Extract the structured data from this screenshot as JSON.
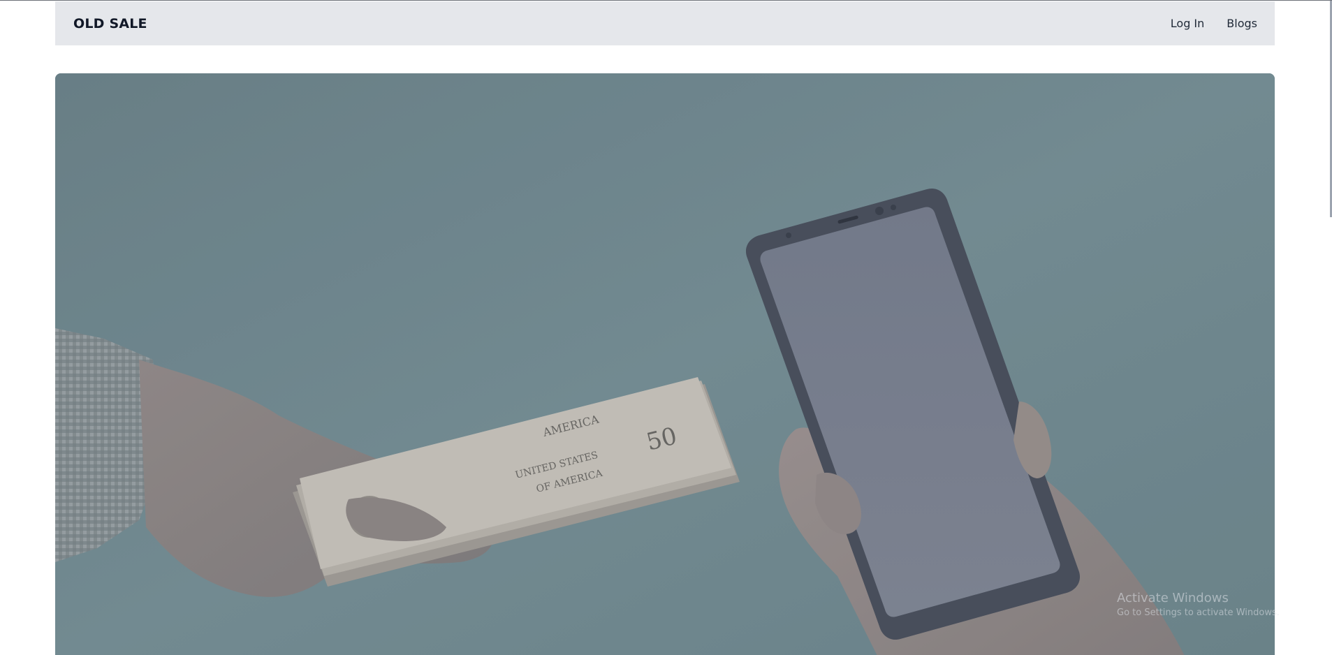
{
  "navbar": {
    "brand": "OLD SALE",
    "links": [
      {
        "label": "Log In"
      },
      {
        "label": "Blogs"
      }
    ]
  },
  "hero": {
    "image": "hand-giving-cash-for-smartphone",
    "bill_text_1": "AMERICA",
    "bill_text_2": "UNITED STATES",
    "bill_text_3": "OF AMERICA",
    "bill_value": "50"
  },
  "watermark": {
    "title": "Activate Windows",
    "subtitle": "Go to Settings to activate Windows."
  },
  "colors": {
    "navbar_bg": "#e5e7eb",
    "hero_bg": "#7a9296",
    "brand_text": "#111827"
  }
}
